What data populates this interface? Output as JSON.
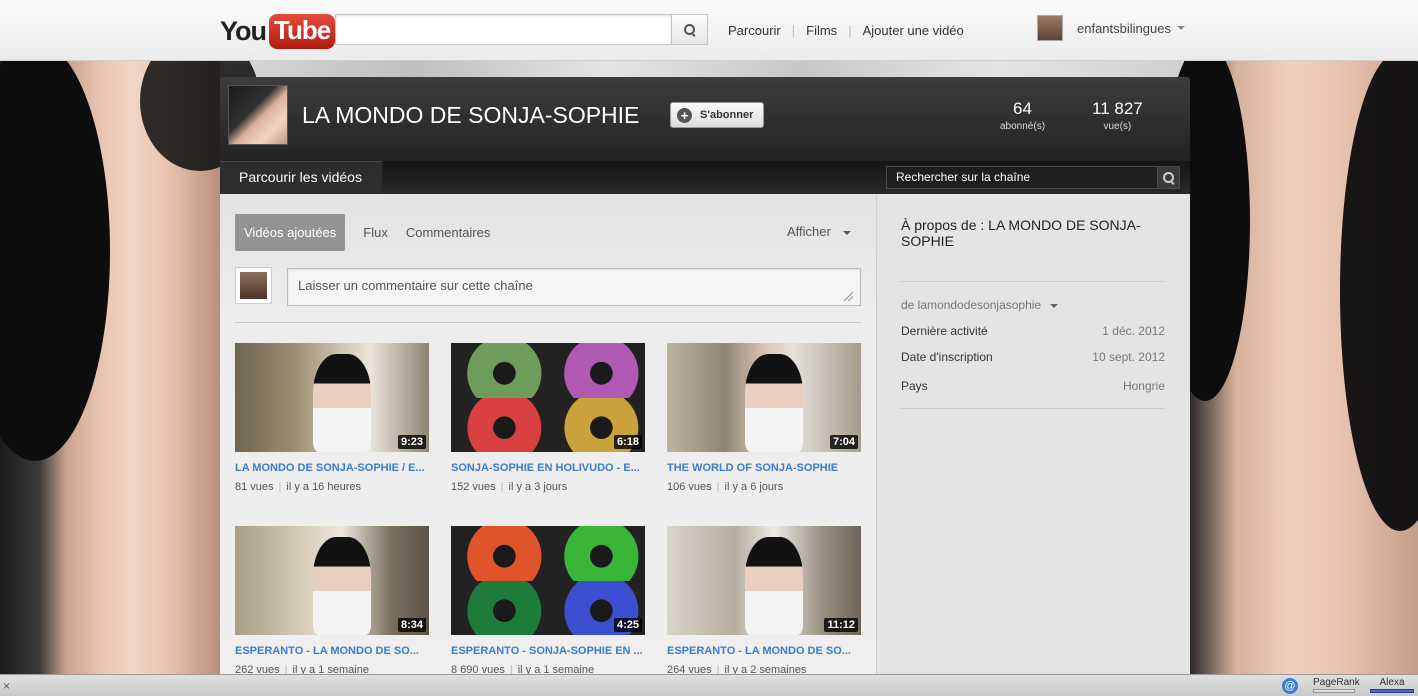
{
  "masthead": {
    "logo_you": "You",
    "logo_tube": "Tube",
    "search_value": "",
    "nav": [
      "Parcourir",
      "Films",
      "Ajouter une vidéo"
    ],
    "username": "enfantsbilingues"
  },
  "channel": {
    "title": "LA MONDO DE SONJA-SOPHIE",
    "subscribe_label": "S'abonner",
    "stats": [
      {
        "value": "64",
        "label": "abonné(s)"
      },
      {
        "value": "11 827",
        "label": "vue(s)"
      }
    ],
    "nav_tab": "Parcourir les vidéos",
    "search_placeholder": "Rechercher sur la chaîne"
  },
  "feed": {
    "tabs": [
      "Vidéos ajoutées",
      "Flux",
      "Commentaires"
    ],
    "afficher": "Afficher",
    "comment_placeholder": "Laisser un commentaire sur cette chaîne"
  },
  "videos": [
    {
      "title": "LA MONDO DE SONJA-SOPHIE / E...",
      "views": "81 vues",
      "age": "il y a 16 heures",
      "duration": "9:23",
      "style": "kitchen"
    },
    {
      "title": "SONJA-SOPHIE EN HOLIVUDO - E...",
      "views": "152 vues",
      "age": "il y a 3 jours",
      "duration": "6:18",
      "style": "popart1"
    },
    {
      "title": "THE WORLD OF SONJA-SOPHIE",
      "views": "106 vues",
      "age": "il y a 6 jours",
      "duration": "7:04",
      "style": "kitchen2"
    },
    {
      "title": "ESPERANTO - LA MONDO DE SO...",
      "views": "262 vues",
      "age": "il y a 1 semaine",
      "duration": "8:34",
      "style": "phone"
    },
    {
      "title": "ESPERANTO - SONJA-SOPHIE EN ...",
      "views": "8 690 vues",
      "age": "il y a 1 semaine",
      "duration": "4:25",
      "style": "popart2"
    },
    {
      "title": "ESPERANTO - LA MONDO DE SO...",
      "views": "264 vues",
      "age": "il y a 2 semaines",
      "duration": "11:12",
      "style": "kitchen3"
    }
  ],
  "about": {
    "title": "À propos de : LA MONDO DE SONJA-SOPHIE",
    "by": "de lamondodesonjasophie",
    "rows": [
      {
        "label": "Dernière activité",
        "value": "1 déc. 2012"
      },
      {
        "label": "Date d'inscription",
        "value": "10 sept. 2012"
      },
      {
        "label": "Pays",
        "value": "Hongrie"
      }
    ]
  },
  "statusbar": {
    "close": "×",
    "at": "@",
    "pagerank": "PageRank",
    "alexa": "Alexa"
  }
}
